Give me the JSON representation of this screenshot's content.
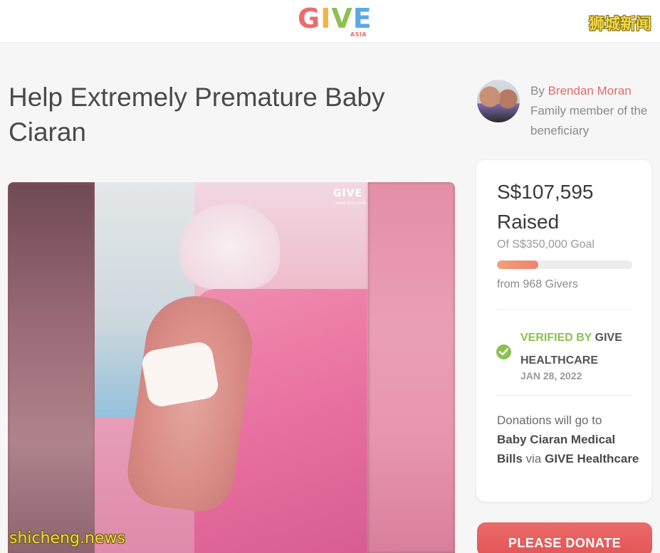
{
  "header": {
    "logo": {
      "part1": "G",
      "part2": "I",
      "part3": "V",
      "part4": "E",
      "sub": "ASIA"
    },
    "watermark": "狮城新闻"
  },
  "campaign": {
    "title": "Help Extremely Premature Baby Ciaran",
    "organizer": {
      "by_label": "By",
      "name": "Brendan Moran",
      "relation": "Family member of the beneficiary"
    },
    "photo": {
      "watermark": "GIVE",
      "watermark_sub": "www.give.asia"
    }
  },
  "sidebar": {
    "amount_raised": "S$107,595",
    "raised_label": "Raised",
    "goal_text": "Of S$350,000 Goal",
    "progress_fraction": 0.307,
    "givers_text": "from 968 Givers",
    "verified": {
      "by_label": "VERIFIED BY",
      "org": "GIVE HEALTHCARE",
      "date": "JAN 28, 2022"
    },
    "donation_dest": {
      "prefix": "Donations will go to",
      "target": "Baby Ciaran Medical Bills",
      "via": "via",
      "org": "GIVE Healthcare"
    },
    "donate_button": "PLEASE DONATE"
  },
  "footer_watermark": "shicheng.news",
  "colors": {
    "accent": "#e26b6b",
    "verified_green": "#8cc152",
    "progress": "#ee8270"
  }
}
